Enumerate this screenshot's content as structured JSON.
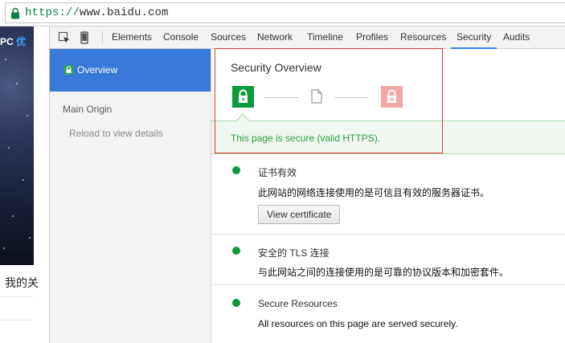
{
  "addressbar": {
    "url_scheme": "https://",
    "url_rest": "www.baidu.com",
    "lock_icon": "lock-icon",
    "accent": "#0b8043"
  },
  "page": {
    "overlay_text_white": "PC",
    "overlay_text_blue": "优",
    "bottom_text": "我的关"
  },
  "devtools": {
    "toolbar": {
      "inspect_icon": "inspect-element-icon",
      "device_icon": "device-mode-icon",
      "tabs": [
        "Elements",
        "Console",
        "Sources",
        "Network",
        "Timeline",
        "Profiles",
        "Resources",
        "Security",
        "Audits"
      ],
      "active_tab": "Security",
      "active_color": "#3e82f7"
    },
    "sidebar": {
      "selected_label": "Overview",
      "main_origin": "Main Origin",
      "reload_hint": "Reload to view details",
      "selected_color": "#3879d9"
    },
    "summary": {
      "title": "Security Overview",
      "explanation": "This page is secure (valid HTTPS).",
      "secure_color": "#0b9b3a",
      "insecure_color": "#f0a8a5"
    },
    "sections": [
      {
        "title": "证书有效",
        "description": "此网站的网络连接使用的是可信且有效的服务器证书。",
        "button": "View certificate",
        "status_color": "#0b9b3a"
      },
      {
        "title": "安全的 TLS 连接",
        "description": "与此网站之间的连接使用的是可靠的协议版本和加密套件。",
        "status_color": "#0b9b3a"
      },
      {
        "title": "Secure Resources",
        "description": "All resources on this page are served securely.",
        "status_color": "#0b9b3a"
      }
    ]
  }
}
